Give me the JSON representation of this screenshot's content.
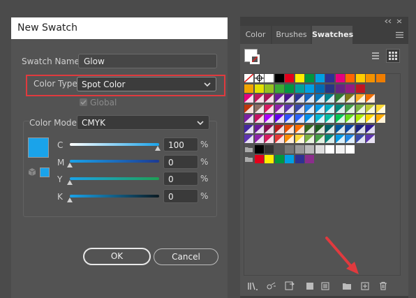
{
  "dialog": {
    "title": "New Swatch",
    "swatch_name_label": "Swatch Name:",
    "swatch_name_value": "Glow",
    "color_type_label": "Color Type:",
    "color_type_value": "Spot Color",
    "global_label": "Global",
    "color_mode_label": "Color Mode:",
    "color_mode_value": "CMYK",
    "channels": [
      {
        "label": "C",
        "value": "100"
      },
      {
        "label": "M",
        "value": "0"
      },
      {
        "label": "Y",
        "value": "0"
      },
      {
        "label": "K",
        "value": "0"
      }
    ],
    "percent": "%",
    "ok_label": "OK",
    "cancel_label": "Cancel",
    "preview_color": "#1aa3ea"
  },
  "panel": {
    "tabs": [
      "Color",
      "Brushes",
      "Swatches"
    ],
    "active_tab": "Swatches",
    "highlight_color": "#e03a3e"
  }
}
